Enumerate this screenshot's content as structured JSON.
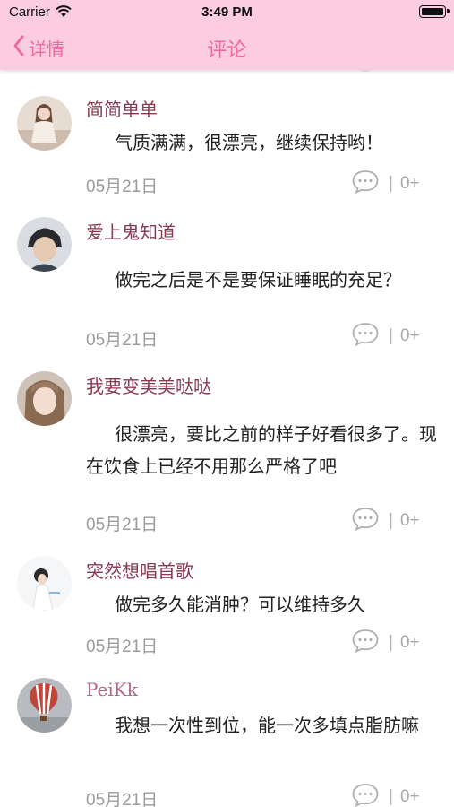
{
  "status_bar": {
    "carrier": "Carrier",
    "time": "3:49 PM"
  },
  "nav": {
    "back_label": "详情",
    "title": "评论"
  },
  "theme": {
    "accent": "#f26a9c",
    "bar_bg": "#fccde0",
    "username_color": "#8a3a50"
  },
  "comments": [
    {
      "user": "简简单单",
      "text": "气质满满，很漂亮，继续保持哟！",
      "date": "05月21日",
      "count": "0+"
    },
    {
      "user": "爱上鬼知道",
      "text": "做完之后是不是要保证睡眠的充足？",
      "date": "05月21日",
      "count": "0+"
    },
    {
      "user": "我要变美美哒哒",
      "text": "很漂亮，要比之前的样子好看很多了。现在饮食上已经不用那么严格了吧",
      "date": "05月21日",
      "count": "0+"
    },
    {
      "user": "突然想唱首歌",
      "text": "做完多久能消肿？可以维持多久",
      "date": "05月21日",
      "count": "0+"
    },
    {
      "user": "PeiKk",
      "text": "我想一次性到位，能一次多填点脂肪嘛",
      "date": "05月21日",
      "count": "0+"
    }
  ],
  "icons": {
    "back": "chevron-left-icon",
    "comment": "comment-bubble-icon",
    "wifi": "wifi-icon",
    "battery": "battery-icon"
  }
}
